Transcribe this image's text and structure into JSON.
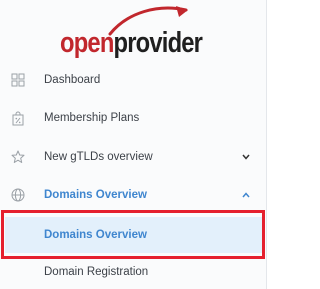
{
  "logo": {
    "part1": "open",
    "part2": "provider"
  },
  "menu": {
    "dashboard": "Dashboard",
    "membership": "Membership Plans",
    "gtlds": "New gTLDs overview",
    "domains": "Domains Overview"
  },
  "submenu": {
    "domains_overview": "Domains Overview",
    "domain_registration": "Domain Registration"
  },
  "colors": {
    "accent": "#3f86cf",
    "brand_red": "#c1272d",
    "highlight": "#e5202e",
    "selected_bg": "#e3f0fb"
  }
}
